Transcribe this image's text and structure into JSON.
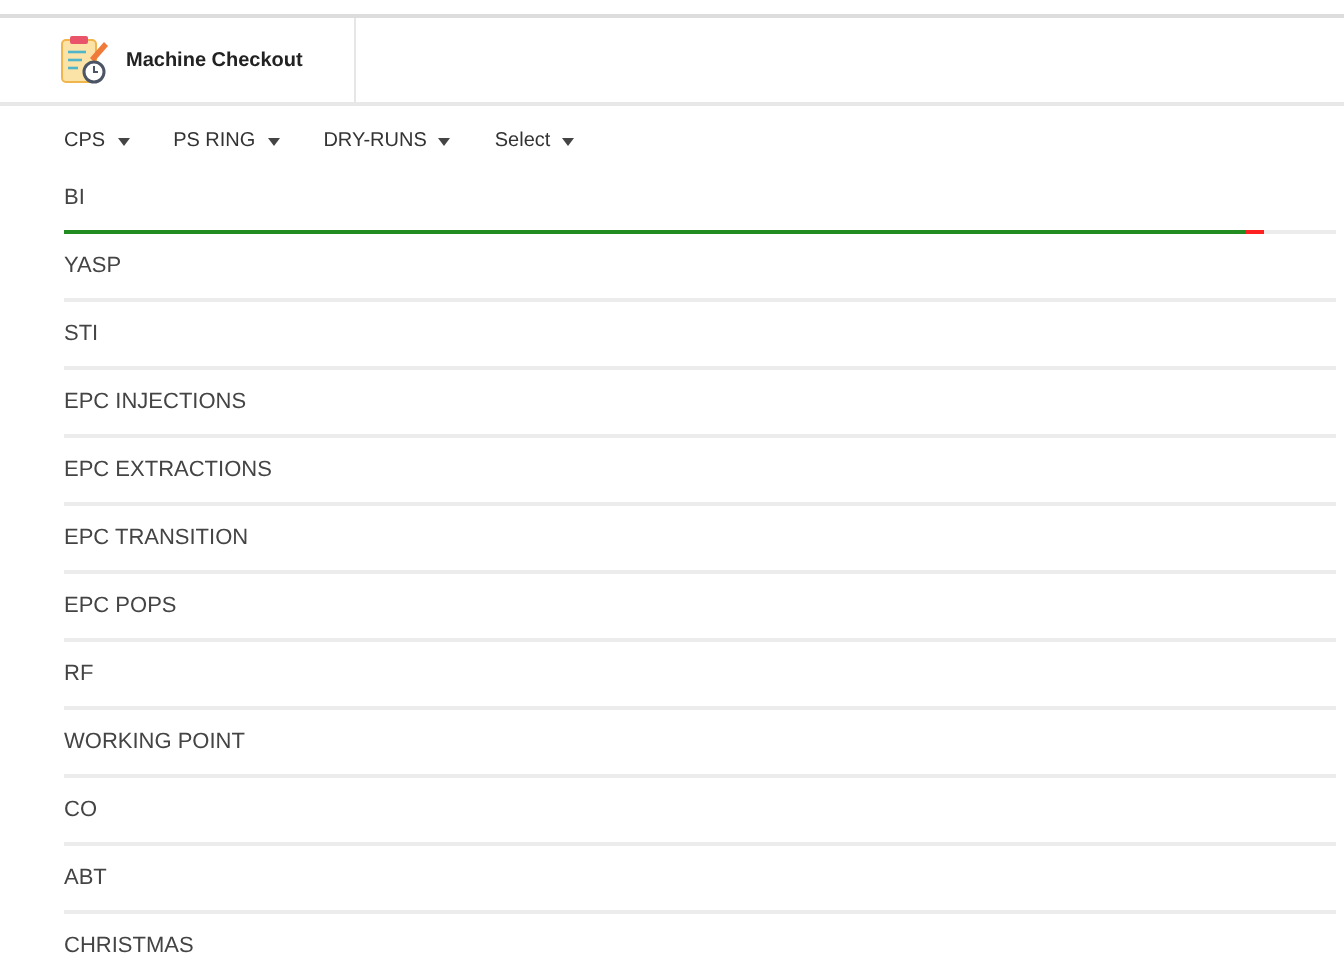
{
  "header": {
    "title": "Machine Checkout"
  },
  "menu": [
    {
      "label": "CPS"
    },
    {
      "label": "PS RING"
    },
    {
      "label": "DRY-RUNS"
    },
    {
      "label": "Select"
    }
  ],
  "rows": [
    {
      "label": "BI",
      "progress": {
        "level": 0.93
      }
    },
    {
      "label": "YASP"
    },
    {
      "label": "STI"
    },
    {
      "label": "EPC INJECTIONS"
    },
    {
      "label": "EPC EXTRACTIONS"
    },
    {
      "label": "EPC TRANSITION"
    },
    {
      "label": "EPC POPS"
    },
    {
      "label": "RF"
    },
    {
      "label": "WORKING POINT"
    },
    {
      "label": "CO"
    },
    {
      "label": "ABT"
    },
    {
      "label": "CHRISTMAS"
    }
  ]
}
